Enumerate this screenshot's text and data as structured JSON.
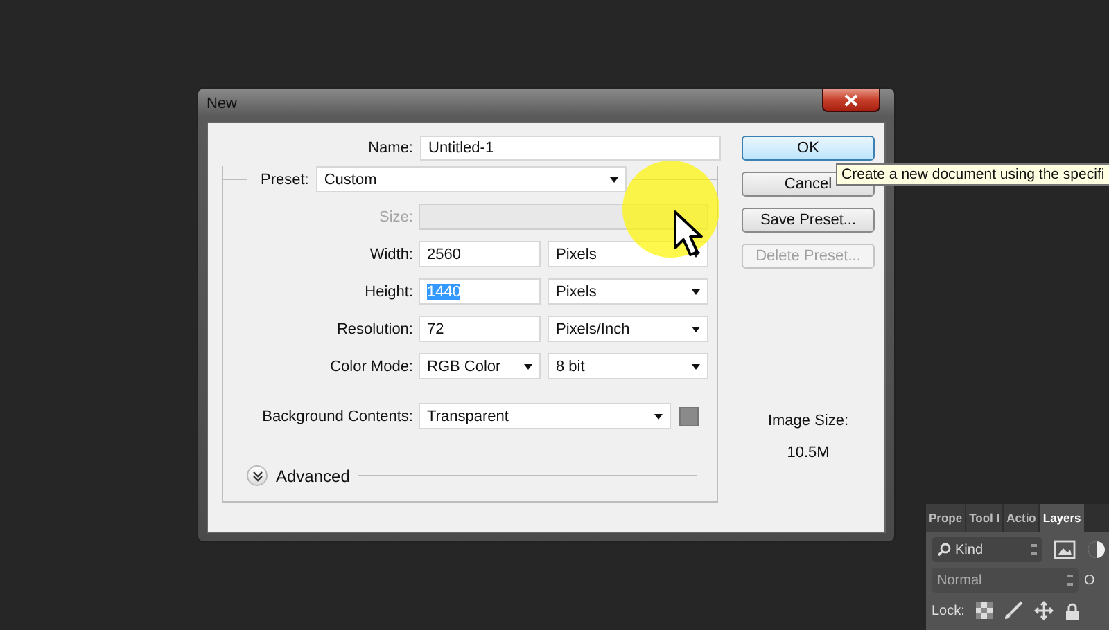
{
  "dialog": {
    "title": "New",
    "name": {
      "label": "Name:",
      "value": "Untitled-1"
    },
    "preset": {
      "label": "Preset:",
      "value": "Custom"
    },
    "rows": [
      {
        "kind": "size",
        "label": "Size:",
        "disabled": true
      },
      {
        "kind": "input",
        "label": "Width:",
        "value": "2560",
        "value_selected": false,
        "unit": "Pixels"
      },
      {
        "kind": "input",
        "label": "Height:",
        "value": "1440",
        "value_selected": true,
        "unit": "Pixels"
      },
      {
        "kind": "input",
        "label": "Resolution:",
        "value": "72",
        "value_selected": false,
        "unit": "Pixels/Inch"
      },
      {
        "kind": "select",
        "label": "Color Mode:",
        "value": "RGB Color",
        "unit": "8 bit"
      }
    ],
    "background": {
      "label": "Background Contents:",
      "value": "Transparent",
      "color": "#8a8a8a"
    },
    "advanced": {
      "label": "Advanced",
      "expanded": false
    },
    "buttons": [
      {
        "label": "OK",
        "default": true,
        "disabled": false
      },
      {
        "label": "Cancel",
        "default": false,
        "disabled": false
      },
      {
        "label": "Save Preset...",
        "default": false,
        "disabled": false
      },
      {
        "label": "Delete Preset...",
        "default": false,
        "disabled": true
      }
    ],
    "image_size": {
      "label": "Image Size:",
      "value": "10.5M"
    }
  },
  "tooltip": "Create a new document using the specifi",
  "layers_panel": {
    "tabs": [
      {
        "label": "Prope",
        "selected": false
      },
      {
        "label": "Tool I",
        "selected": false
      },
      {
        "label": "Actio",
        "selected": false
      },
      {
        "label": "Layers",
        "selected": true
      }
    ],
    "filter": {
      "placeholder": "Kind"
    },
    "blend_mode": "Normal",
    "opacity_label": "O",
    "lock_label": "Lock:"
  }
}
